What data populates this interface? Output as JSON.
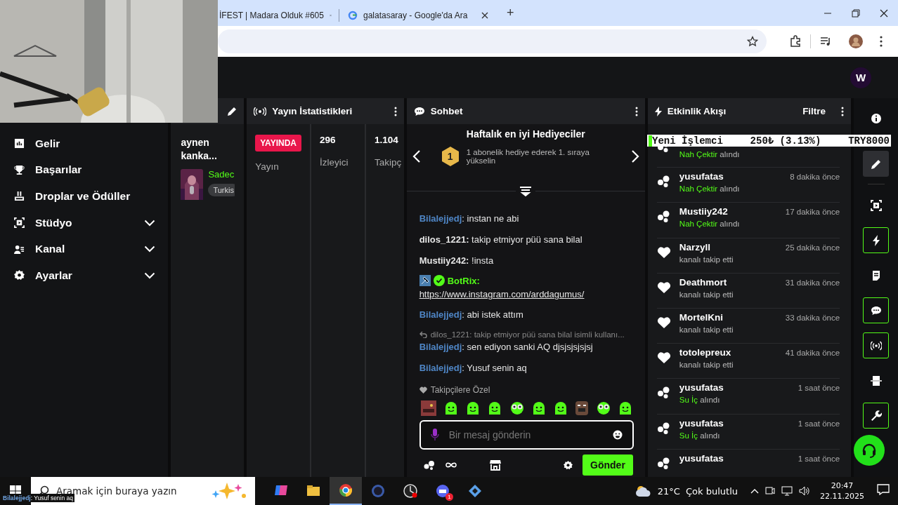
{
  "browser": {
    "tabs": [
      {
        "title": "İFEST | Madara Olduk #605",
        "selected": false
      },
      {
        "title": "galatasaray - Google'da Ara",
        "selected": false
      }
    ],
    "new_tab": "+"
  },
  "app_header": {
    "avatar": "W"
  },
  "sidebar": {
    "items": [
      {
        "label": "Gelir",
        "kind": "link"
      },
      {
        "label": "Başarılar",
        "kind": "link"
      },
      {
        "label": "Droplar ve Ödüller",
        "kind": "link"
      },
      {
        "label": "Stüdyo",
        "kind": "group",
        "expanded": false
      },
      {
        "label": "Kanal",
        "kind": "group",
        "expanded": false
      },
      {
        "label": "Ayarlar",
        "kind": "group",
        "expanded": false
      }
    ]
  },
  "stream_card": {
    "title": "aynen kanka...",
    "category": "Sadec",
    "tag": "Turkis"
  },
  "stats": {
    "title": "Yayın İstatistikleri",
    "columns": [
      {
        "kind": "badge",
        "value": "YAYINDA",
        "label": "Yayın"
      },
      {
        "kind": "number",
        "value": "296",
        "label": "İzleyici"
      },
      {
        "kind": "number",
        "value": "1.104",
        "label": "Takipç"
      }
    ]
  },
  "chat": {
    "title": "Sohbet",
    "gifters": {
      "title": "Haftalık en iyi Hediyeciler",
      "rank": "1",
      "text": "1 abonelik hediye ederek 1. sıraya yükselin"
    },
    "messages": [
      {
        "kind": "message",
        "user": "Bilalejjedj",
        "color": "#4f86c6",
        "text": ": instan ne abi"
      },
      {
        "kind": "message",
        "user": "dilos_1221:",
        "color": "#e6e6e6",
        "text": " takip etmiyor püü sana bilal"
      },
      {
        "kind": "message",
        "user": "Mustiiy242:",
        "color": "#e6e6e6",
        "text": " !insta"
      },
      {
        "kind": "bot",
        "user": "BotRix:",
        "color": "#53fc18",
        "link": "https://www.instagram.com/arddagumus/"
      },
      {
        "kind": "message",
        "user": "Bilalejjedj",
        "color": "#4f86c6",
        "text": ": abi istek attım"
      },
      {
        "kind": "reply",
        "reply_to": "dilos_1221: takip etmiyor püü sana bilal isimli kullanı...",
        "user": "Bilalejjedj",
        "color": "#4f86c6",
        "text": ": sen ediyon sanki AQ djsjsjsjsjsj"
      },
      {
        "kind": "message",
        "user": "Bilalejjedj",
        "color": "#4f86c6",
        "text": ": Yusuf senin aq"
      }
    ],
    "emote_section": "Takipçilere Özel",
    "input": {
      "placeholder": "Bir mesaj gönderin"
    },
    "send_button": "Gönder"
  },
  "activity": {
    "title": "Etkinlik Akışı",
    "filter": "Filtre",
    "items": [
      {
        "kind": "gift",
        "item": "Nah Çektir",
        "action": " alındı"
      },
      {
        "kind": "gift",
        "user": "yusufatas",
        "time": "8 dakika önce",
        "item": "Nah Çektir",
        "action": " alındı"
      },
      {
        "kind": "gift",
        "user": "Mustiiy242",
        "time": "17 dakika önce",
        "item": "Nah Çektir",
        "action": " alındı"
      },
      {
        "kind": "follow",
        "user": "Narzyll",
        "time": "25 dakika önce",
        "action": "kanalı takip etti"
      },
      {
        "kind": "follow",
        "user": "Deathmort",
        "time": "31 dakika önce",
        "action": "kanalı takip etti"
      },
      {
        "kind": "follow",
        "user": "MortelKni",
        "time": "33 dakika önce",
        "action": "kanalı takip etti"
      },
      {
        "kind": "follow",
        "user": "totolepreux",
        "time": "41 dakika önce",
        "action": "kanalı takip etti"
      },
      {
        "kind": "gift",
        "user": "yusufatas",
        "time": "1 saat önce",
        "item": "Su İç",
        "action": " alındı"
      },
      {
        "kind": "gift",
        "user": "yusufatas",
        "time": "1 saat önce",
        "item": "Su İç",
        "action": " alındı"
      },
      {
        "kind": "gift",
        "user": "yusufatas",
        "time": "1 saat önce"
      }
    ]
  },
  "ticker": {
    "name": "Yeni İşlemci",
    "price": "250₺ (3.13%)",
    "target": "TRY8000"
  },
  "rail": [
    {
      "selected": false,
      "on": false
    },
    {
      "selected": true,
      "on": false
    },
    {
      "selected": false,
      "on": false
    },
    {
      "selected": false,
      "on": true
    },
    {
      "selected": false,
      "on": false
    },
    {
      "selected": false,
      "on": true
    },
    {
      "selected": false,
      "on": true
    },
    {
      "selected": false,
      "on": false
    },
    {
      "selected": false,
      "on": true
    }
  ],
  "taskbar": {
    "search": {
      "placeholder": "Aramak için buraya yazın"
    },
    "apps": [
      {
        "selected": false
      },
      {
        "selected": false
      },
      {
        "selected": true
      },
      {
        "selected": false
      },
      {
        "selected": false
      },
      {
        "selected": false,
        "badge": "1"
      },
      {
        "selected": false
      }
    ],
    "weather": "21°C  Çok bulutlu",
    "time": "20:47",
    "date": "22.11.2025"
  },
  "overlay_chat": {
    "user": "Bilalejjedj",
    "text": ": Yusuf senin aq"
  }
}
